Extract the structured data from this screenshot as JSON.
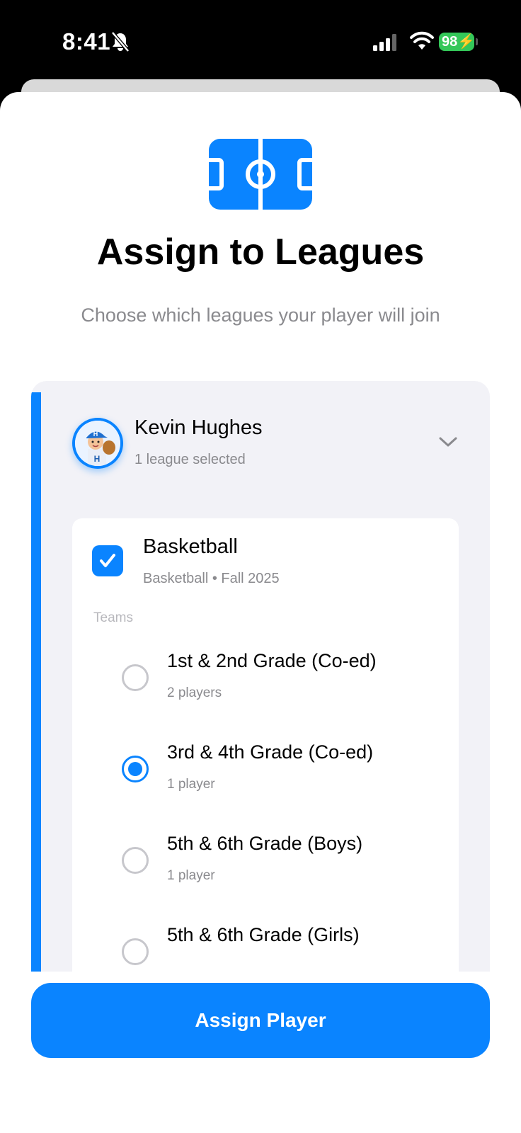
{
  "status_bar": {
    "time": "8:41",
    "battery": "98"
  },
  "header": {
    "title": "Assign to Leagues",
    "subtitle": "Choose which leagues your player will join"
  },
  "player": {
    "name": "Kevin Hughes",
    "summary": "1 league selected"
  },
  "league": {
    "name": "Basketball",
    "detail": "Basketball • Fall 2025",
    "checked": true,
    "teams_label": "Teams",
    "teams": [
      {
        "name": "1st & 2nd Grade (Co-ed)",
        "count": "2 players",
        "selected": false
      },
      {
        "name": "3rd & 4th Grade (Co-ed)",
        "count": "1 player",
        "selected": true
      },
      {
        "name": "5th & 6th Grade (Boys)",
        "count": "1 player",
        "selected": false
      },
      {
        "name": "5th & 6th Grade (Girls)",
        "count": "",
        "selected": false
      }
    ]
  },
  "actions": {
    "assign_label": "Assign Player"
  },
  "colors": {
    "accent": "#0a84ff",
    "background": "#f2f2f7",
    "battery": "#34c759"
  }
}
